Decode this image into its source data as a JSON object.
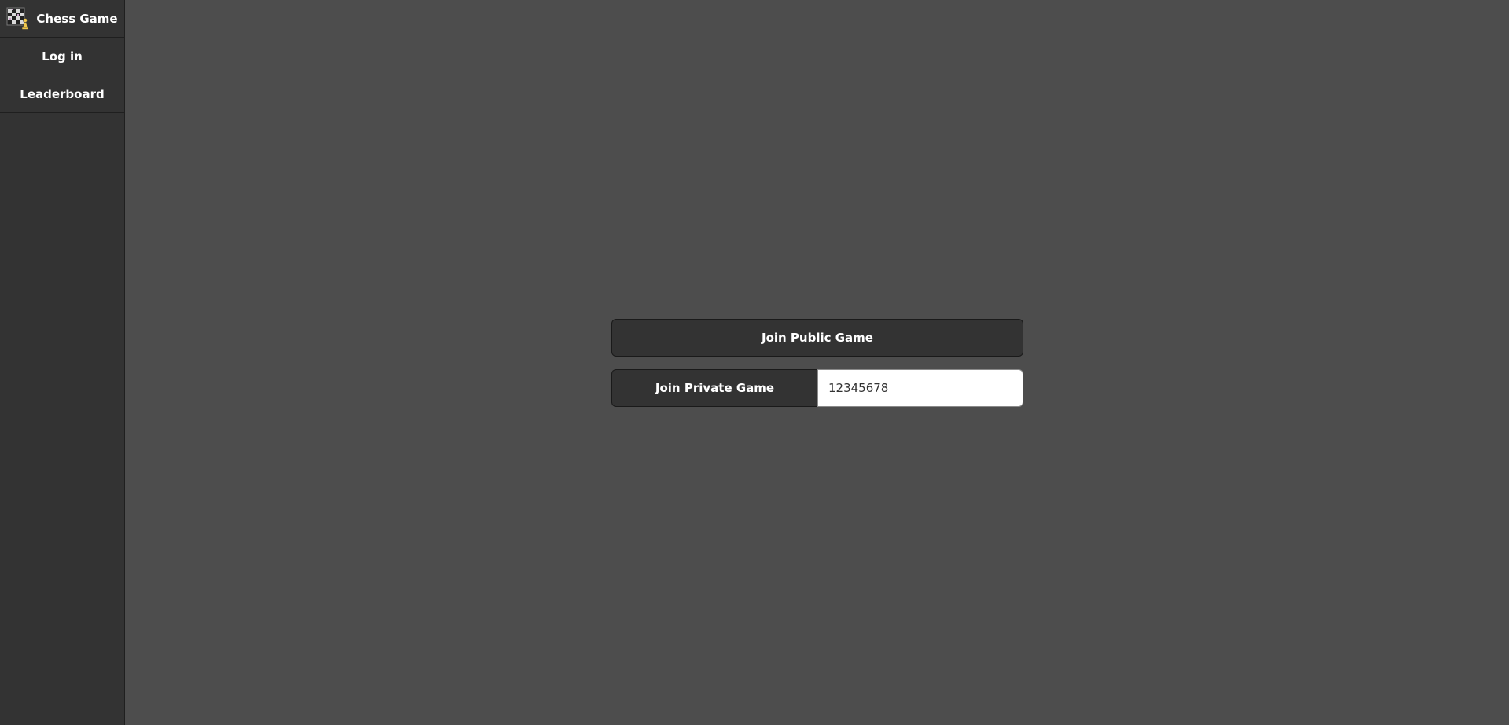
{
  "sidebar": {
    "brand": {
      "label": "Chess Game",
      "icon": "chess-logo-icon"
    },
    "items": [
      {
        "label": "Log in"
      },
      {
        "label": "Leaderboard"
      }
    ]
  },
  "main": {
    "public_button_label": "Join Public Game",
    "private_button_label": "Join Private Game",
    "private_code_value": "12345678"
  },
  "colors": {
    "background": "#4d4d4d",
    "sidebar": "#333333",
    "button": "#333333",
    "text": "#ffffff"
  }
}
